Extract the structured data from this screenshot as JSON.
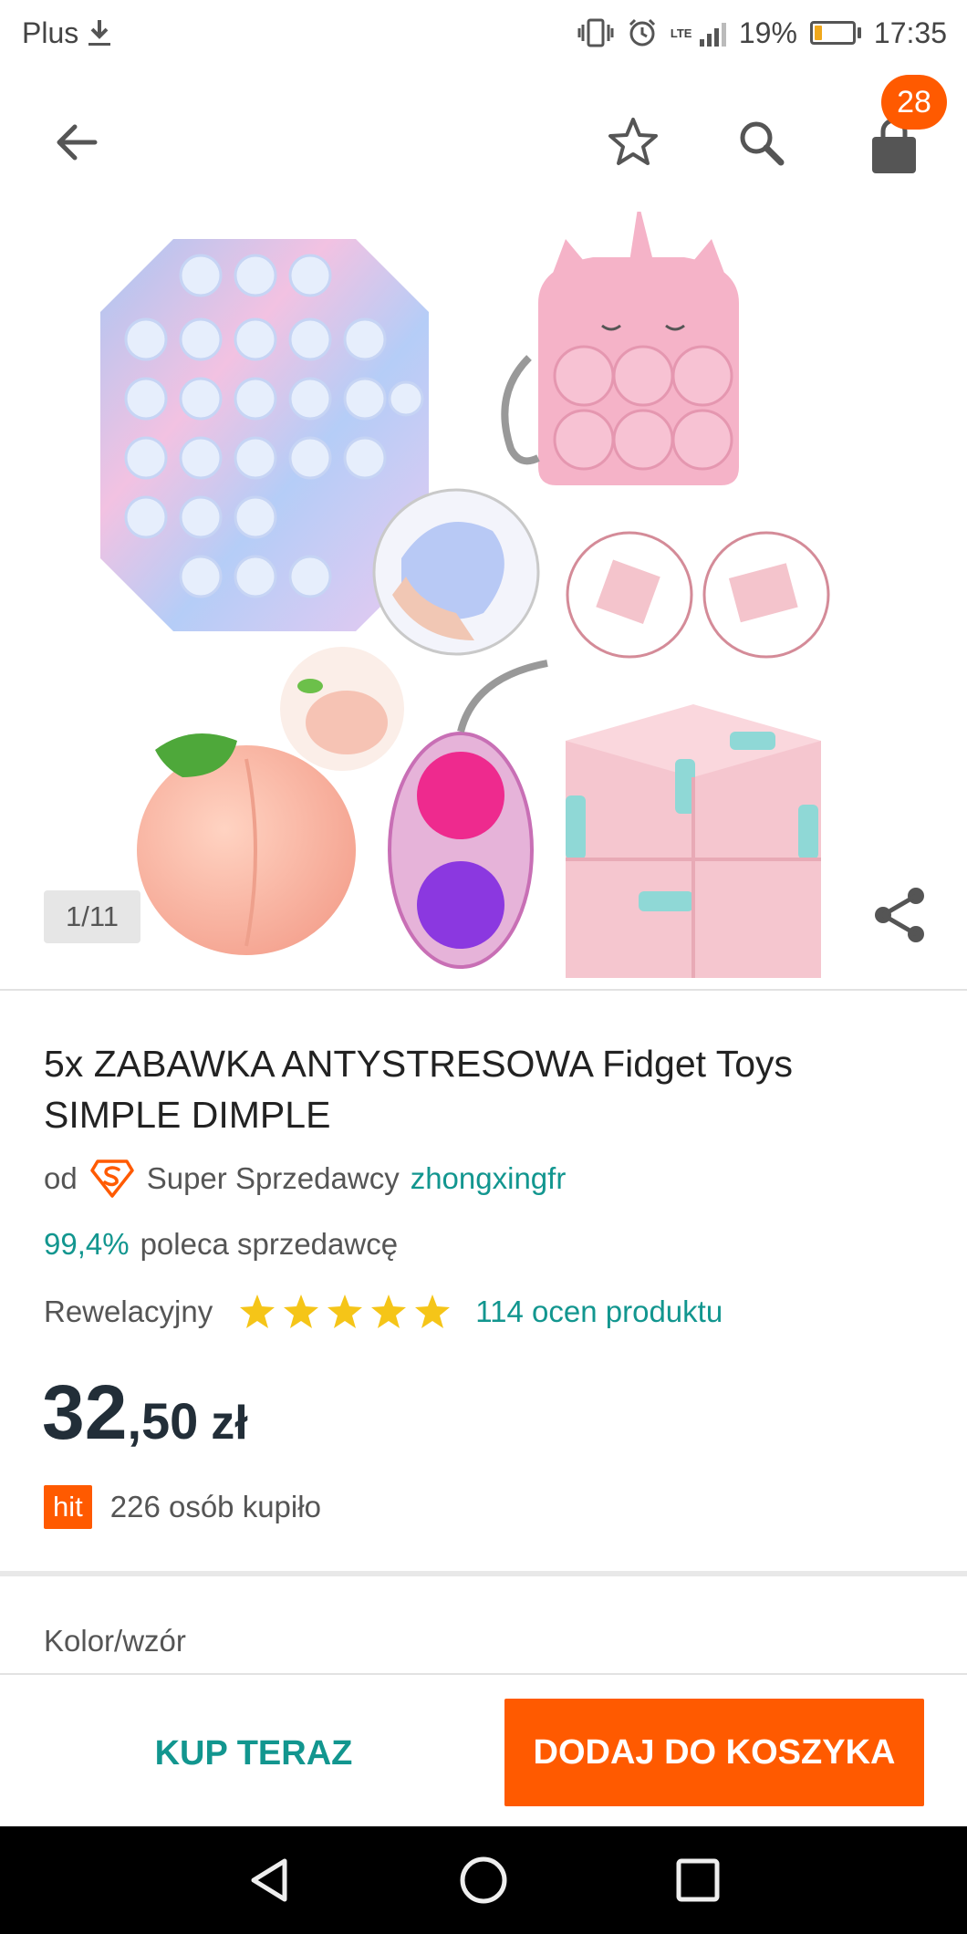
{
  "status_bar": {
    "carrier": "Plus",
    "network": "LTE",
    "battery": "19%",
    "battery_level": 0.19,
    "time": "17:35"
  },
  "app_bar": {
    "cart_count": "28",
    "icons": [
      "arrow-back-icon",
      "star-outline-icon",
      "search-icon",
      "shopping-bag-icon"
    ]
  },
  "gallery": {
    "counter": "1/11",
    "image_description_icons": [
      "share-icon"
    ]
  },
  "product": {
    "title": "5x ZABAWKA ANTYSTRESOWA Fidget Toys SIMPLE DIMPLE",
    "seller_prefix": "od",
    "seller_badge": "Super Sprzedawcy",
    "seller_name": "zhongxingfr",
    "recommend_pct": "99,4%",
    "recommend_text": "poleca sprzedawcę",
    "rating_label": "Rewelacyjny",
    "rating": 5,
    "reviews_link": "114 ocen produktu",
    "price_main": "32",
    "price_rest": ",50",
    "price_currency": "zł",
    "hit_badge": "hit",
    "bought_text": "226 osób kupiło",
    "variant_label": "Kolor/wzór"
  },
  "actions": {
    "buy_now": "KUP TERAZ",
    "add_to_cart": "DODAJ DO KOSZYKA"
  },
  "colors": {
    "accent_orange": "#ff5a00",
    "accent_teal": "#12968f",
    "star_yellow": "#f5c518",
    "price_dark": "#222e38"
  }
}
